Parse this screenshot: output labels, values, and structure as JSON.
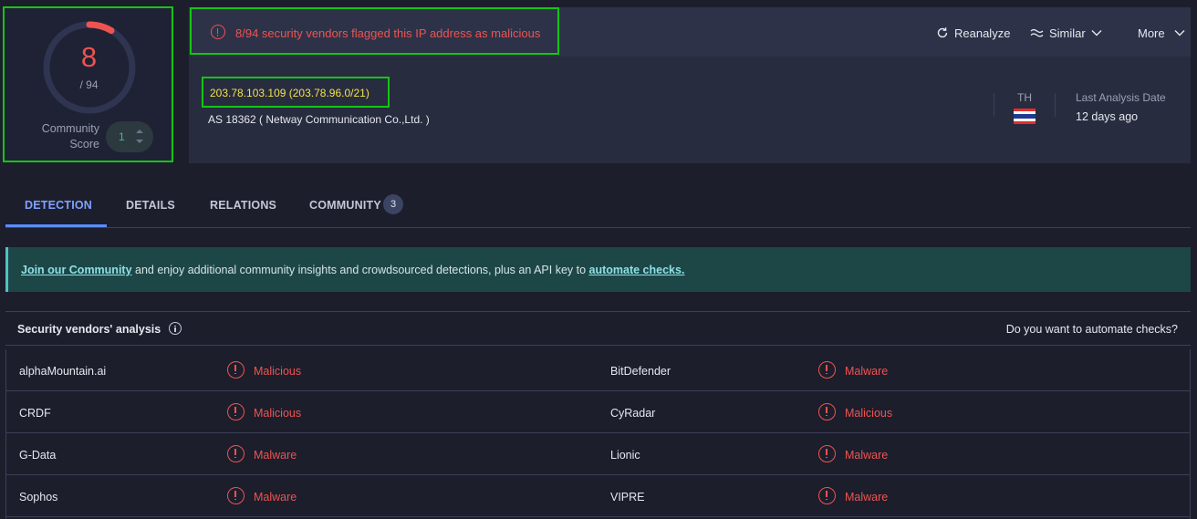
{
  "score": {
    "detections": "8",
    "total": "/ 94",
    "ratio": 0.0851,
    "community_label_line1": "Community",
    "community_label_line2": "Score",
    "community_value": "1"
  },
  "alert": {
    "text": "8/94 security vendors flagged this IP address as malicious",
    "color": "#ef5350"
  },
  "actions": {
    "reanalyze": "Reanalyze",
    "similar": "Similar",
    "more": "More"
  },
  "ip": {
    "address_line": "203.78.103.109  (203.78.96.0/21)",
    "as_line": "AS 18362   ( Netway Communication Co.,Ltd. )",
    "country_code": "TH",
    "last_analysis_label": "Last Analysis Date",
    "last_analysis_value": "12 days ago"
  },
  "tabs": [
    {
      "label": "DETECTION",
      "active": true
    },
    {
      "label": "DETAILS",
      "active": false
    },
    {
      "label": "RELATIONS",
      "active": false
    },
    {
      "label": "COMMUNITY",
      "active": false,
      "badge": "3"
    }
  ],
  "banner": {
    "link1": "Join our Community",
    "middle": " and enjoy additional community insights and crowdsourced detections, plus an API key to ",
    "link2": "automate checks."
  },
  "analysis": {
    "title": "Security vendors' analysis",
    "automate_question": "Do you want to automate checks?"
  },
  "vendors": [
    {
      "left_name": "alphaMountain.ai",
      "left_result": "Malicious",
      "right_name": "BitDefender",
      "right_result": "Malware"
    },
    {
      "left_name": "CRDF",
      "left_result": "Malicious",
      "right_name": "CyRadar",
      "right_result": "Malicious"
    },
    {
      "left_name": "G-Data",
      "left_result": "Malware",
      "right_name": "Lionic",
      "right_result": "Malware"
    },
    {
      "left_name": "Sophos",
      "left_result": "Malware",
      "right_name": "VIPRE",
      "right_result": "Malware"
    }
  ],
  "colors": {
    "background": "#1c1e2c",
    "malicious_red": "#ef5350",
    "highlight_green": "#16c416",
    "ip_yellow": "#f2e24a",
    "active_tab_blue": "#7fa2ff",
    "banner_teal": "#1d4747"
  },
  "icons": {
    "reanalyze": "refresh-icon",
    "similar": "similar-icon",
    "dropdown": "chevron-down-icon",
    "alert": "alert-circle-icon",
    "info": "info-icon",
    "country_flag": "thailand-flag-icon"
  }
}
